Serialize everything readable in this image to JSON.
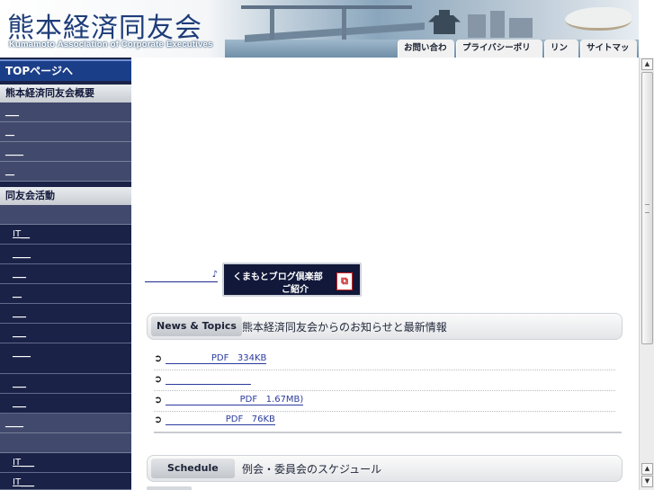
{
  "header": {
    "site_title": "熊本経済同友会",
    "site_subtitle": "Kumamoto Association of Corporate Executives",
    "util_nav": [
      "お問い合わせ",
      "プライバシーポリシー",
      "リンク",
      "サイトマップ"
    ]
  },
  "sidebar": {
    "top_link": "TOPページへ",
    "section_overview": "熊本経済同友会概要",
    "overview_items": [
      "___",
      "__",
      "____",
      "__"
    ],
    "section_activities": "同友会活動",
    "activity_items": [
      "IT__",
      "____",
      "___",
      "__",
      "___",
      "___",
      "____",
      "___",
      "___",
      "___",
      "____",
      "IT___",
      "IT___"
    ]
  },
  "main": {
    "blog_link_text": "♪",
    "blog_banner_line1": "くまもとブログ倶楽部",
    "blog_banner_line2": "ご紹介",
    "blog_banner_icon": "pdf-icon",
    "news_tab": "News & Topics",
    "news_desc": "熊本経済同友会からのお知らせと最新情報",
    "news_items": [
      "                PDF   334KB",
      "                              ",
      "                          PDF   1.67MB)",
      "                     PDF   76KB"
    ],
    "schedule_tab": "Schedule",
    "schedule_desc": "例会・委員会のスケジュール"
  },
  "scrollbar": {
    "up_icon": "arrow-up-icon",
    "down_icon": "arrow-down-icon"
  },
  "colors": {
    "sidebar_bg": "#1a2248",
    "sidebar_band": "#414a6c",
    "link": "#2b3b9e",
    "title": "#1d3c78"
  }
}
